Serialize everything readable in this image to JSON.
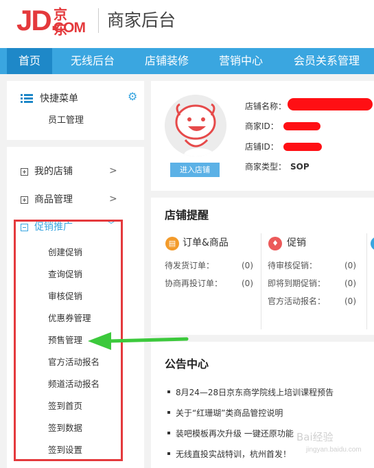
{
  "header": {
    "logo_jd": "JD.",
    "logo_cn": "京东",
    "logo_com": "COM",
    "title": "商家后台"
  },
  "nav": {
    "items": [
      {
        "label": "首页",
        "active": true
      },
      {
        "label": "无线后台"
      },
      {
        "label": "店铺装修"
      },
      {
        "label": "营销中心"
      },
      {
        "label": "会员关系管理"
      }
    ]
  },
  "quick_menu": {
    "title": "快捷菜单",
    "items": [
      "员工管理"
    ]
  },
  "sidebar": {
    "groups": [
      {
        "label": "我的店铺",
        "expanded": false
      },
      {
        "label": "商品管理",
        "expanded": false
      },
      {
        "label": "促销推广",
        "expanded": true,
        "items": [
          "创建促销",
          "查询促销",
          "审核促销",
          "优惠券管理",
          "预售管理",
          "官方活动报名",
          "频道活动报名",
          "签到首页",
          "签到数据",
          "签到设置"
        ]
      }
    ]
  },
  "store": {
    "enter_button": "进入店铺",
    "fields": [
      {
        "label": "店铺名称："
      },
      {
        "label": "商家ID："
      },
      {
        "label": "店铺ID："
      },
      {
        "label": "商家类型：",
        "value": "SOP"
      }
    ]
  },
  "reminder": {
    "title": "店铺提醒",
    "columns": [
      {
        "heading": "订单&商品",
        "icon": "document-icon",
        "rows": [
          {
            "label": "待发货订单：",
            "count": "(0)"
          },
          {
            "label": "协商再投订单：",
            "count": "(0)"
          }
        ]
      },
      {
        "heading": "促销",
        "icon": "promotion-icon",
        "rows": [
          {
            "label": "待审核促销：",
            "count": "(0)"
          },
          {
            "label": "即将到期促销：",
            "count": "(0)"
          },
          {
            "label": "官方活动报名：",
            "count": "(0)"
          }
        ]
      }
    ]
  },
  "notices": {
    "title": "公告中心",
    "items": [
      "8月24—28日京东商学院线上培训课程预告",
      "关于“红珊瑚”类商品管控说明",
      "装吧模板再次升级 一键还原功能",
      "无线直投实战特训，杭州首发！"
    ]
  },
  "watermark": {
    "text": "Bai经验",
    "sub": "jingyan.baidu.com"
  },
  "colors": {
    "brand_red": "#e4393c",
    "nav_blue": "#3aa6e0",
    "nav_active": "#1e88c8",
    "arrow_green": "#3cc93c",
    "highlight_red": "#e4393c"
  }
}
